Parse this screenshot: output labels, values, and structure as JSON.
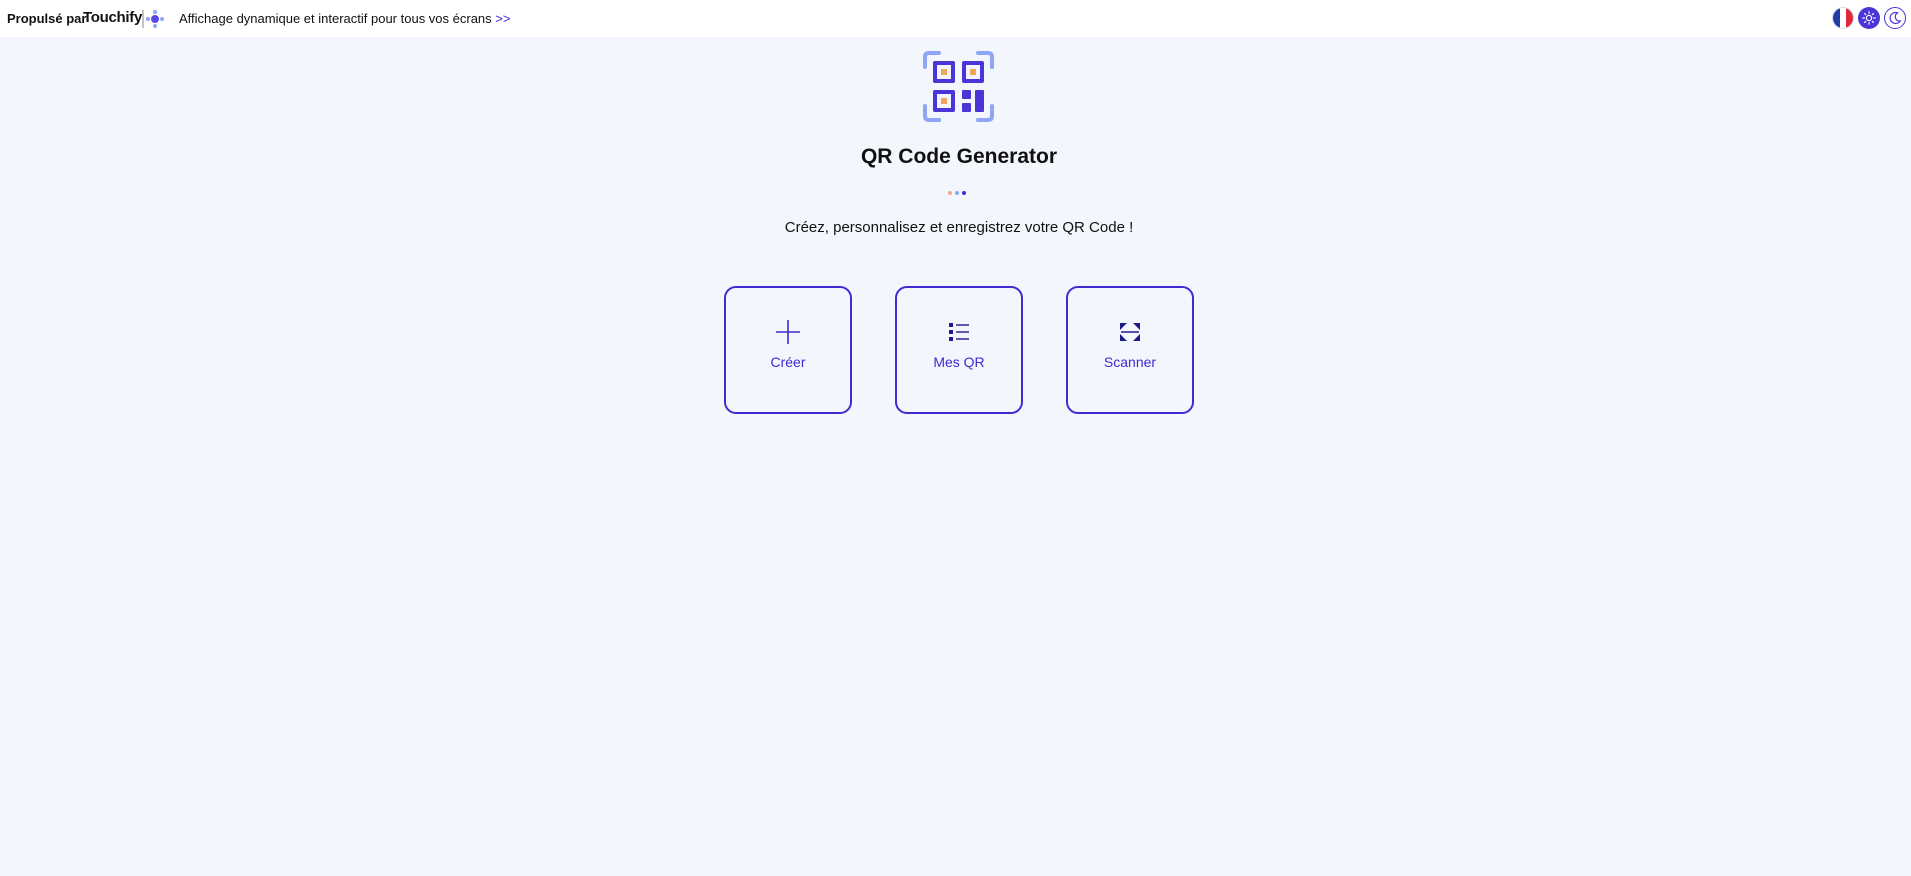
{
  "topbar": {
    "powered_label": "Propulsé par",
    "brand_name": "Touchify",
    "tagline": "Affichage dynamique et interactif pour tous vos écrans",
    "tagline_arrow": ">>",
    "language_icon": "flag-france-icon",
    "light_theme_icon": "sun-icon",
    "dark_theme_icon": "moon-icon"
  },
  "main": {
    "hero_icon": "qr-code-icon",
    "title": "QR Code Generator",
    "subtitle": "Créez, personnalisez et enregistrez votre QR Code !",
    "actions": [
      {
        "label": "Créer",
        "icon": "plus-icon"
      },
      {
        "label": "Mes QR",
        "icon": "list-icon"
      },
      {
        "label": "Scanner",
        "icon": "scan-icon"
      }
    ]
  },
  "colors": {
    "accent": "#3d2cd0",
    "accent_light": "#8fa6f5",
    "background": "#f3f6fd",
    "qr_inner": "#f2a55a"
  }
}
